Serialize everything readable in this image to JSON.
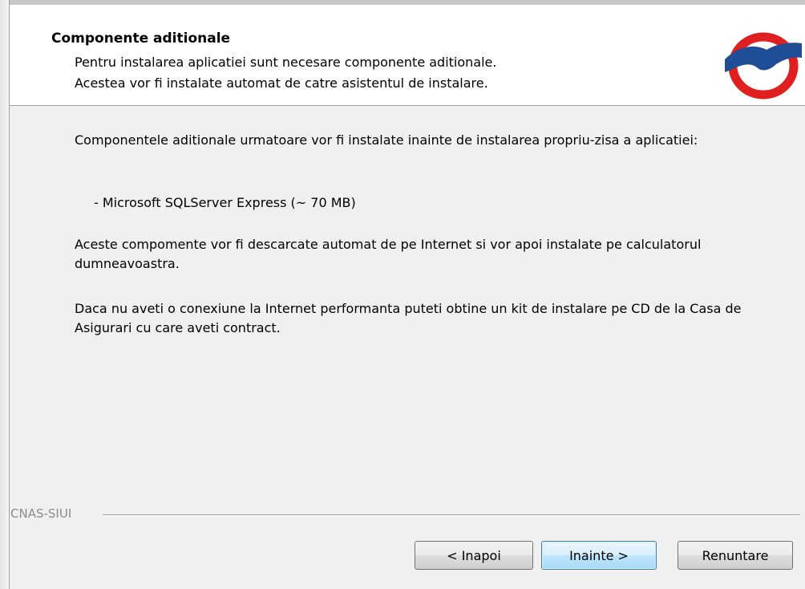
{
  "header": {
    "title": "Componente aditionale",
    "subtitle_line1": "Pentru instalarea aplicatiei sunt necesare componente aditionale.",
    "subtitle_line2": "Acestea vor fi instalate automat de catre asistentul de instalare."
  },
  "content": {
    "paragraph1": "Componentele aditionale urmatoare vor fi instalate inainte de instalarea propriu-zisa a aplicatiei:",
    "component_item": "- Microsoft SQLServer Express (~ 70 MB)",
    "paragraph2": "Aceste compomente vor fi descarcate automat de pe Internet si vor apoi instalate pe calculatorul dumneavoastra.",
    "paragraph3": "Daca nu aveti o conexiune la Internet performanta puteti obtine un kit de instalare pe CD de la Casa de Asigurari cu care aveti contract."
  },
  "footer": {
    "brand": "CNAS-SIUI",
    "back_label": "< Inapoi",
    "next_label": "Inainte >",
    "cancel_label": "Renuntare"
  },
  "colors": {
    "logo_red": "#e02020",
    "logo_blue": "#1f4e96",
    "header_bg": "#ffffff",
    "body_bg": "#f0f0f0",
    "default_button_border": "#3c7fb1"
  },
  "icons": {
    "logo": "cnas-logo-icon"
  }
}
